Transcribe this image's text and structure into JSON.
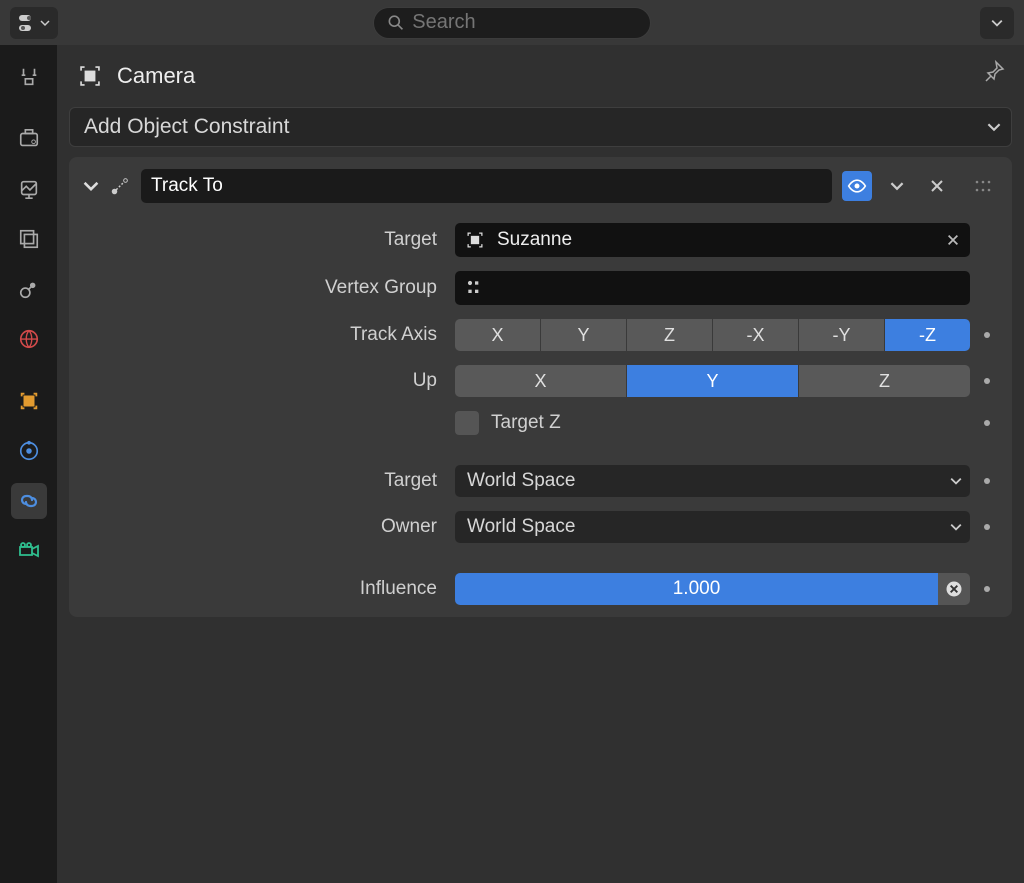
{
  "search": {
    "placeholder": "Search"
  },
  "breadcrumb": {
    "object_name": "Camera"
  },
  "add_constraint_label": "Add Object Constraint",
  "sidebar_tabs": [
    "tool",
    "render",
    "output",
    "view-layer",
    "scene",
    "world",
    "object",
    "physics",
    "constraints",
    "data"
  ],
  "sidebar_active": "constraints",
  "constraint": {
    "type_name": "Track To",
    "labels": {
      "target": "Target",
      "vertex_group": "Vertex Group",
      "track_axis": "Track Axis",
      "up": "Up",
      "target_z": "Target Z",
      "target_space": "Target",
      "owner_space": "Owner",
      "influence": "Influence"
    },
    "target_value": "Suzanne",
    "vertex_group_value": "",
    "track_axis_options": [
      "X",
      "Y",
      "Z",
      "-X",
      "-Y",
      "-Z"
    ],
    "track_axis_selected": "-Z",
    "up_options": [
      "X",
      "Y",
      "Z"
    ],
    "up_selected": "Y",
    "target_z_checked": false,
    "target_space": "World Space",
    "owner_space": "World Space",
    "influence": "1.000"
  }
}
